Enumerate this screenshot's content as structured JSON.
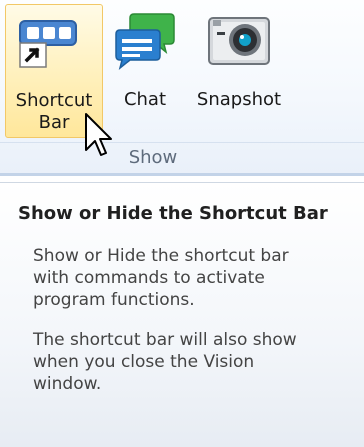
{
  "ribbon": {
    "group_label": "Show",
    "buttons": [
      {
        "label_line1": "Shortcut",
        "label_line2": "Bar",
        "icon": "shortcut-bar-icon"
      },
      {
        "label": "Chat",
        "icon": "chat-icon"
      },
      {
        "label": "Snapshot",
        "icon": "camera-icon"
      }
    ]
  },
  "tooltip": {
    "title": "Show or Hide the Shortcut Bar",
    "paragraph1_lines": [
      "Show or Hide the shortcut bar",
      "with commands to activate",
      "program functions."
    ],
    "paragraph2_lines": [
      "The shortcut bar will also show",
      "when you close the Vision",
      "window."
    ]
  },
  "colors": {
    "hover_highlight": "#ffe79b",
    "chat_green": "#3fb34a",
    "chat_blue": "#2a7fcf"
  }
}
